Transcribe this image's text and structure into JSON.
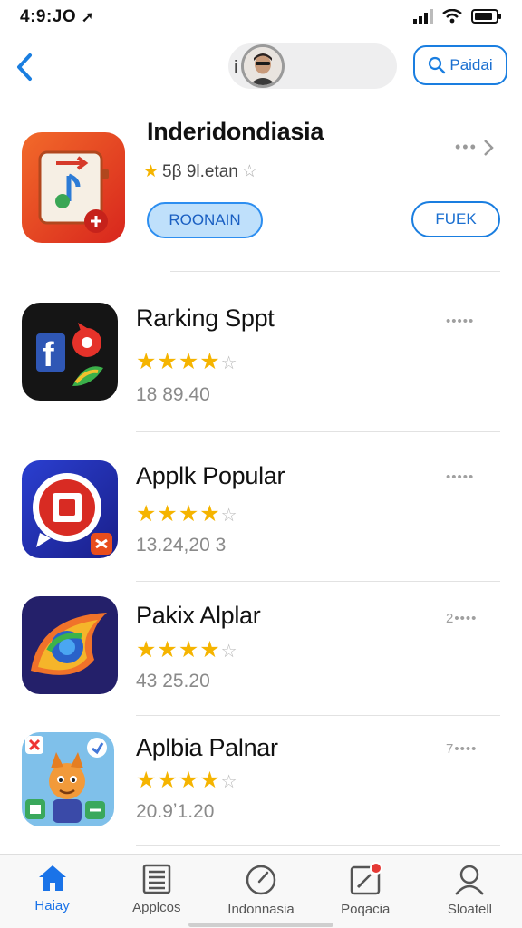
{
  "status_bar": {
    "time": "4:9:ЈО"
  },
  "nav": {
    "cursor_glyph": "i",
    "action_button_label": "Paidai"
  },
  "featured": {
    "title": "Inderidondiasia",
    "rating_text": "5β 9l.etan",
    "primary_button_label": "ROONAIN",
    "secondary_button_label": "FUEK"
  },
  "apps": [
    {
      "name": "Rarking Sppt",
      "rating": 4,
      "meta": "18 89.40",
      "more": ""
    },
    {
      "name": "Applk Popular",
      "rating": 4,
      "meta": "13.24,20 3",
      "more": ""
    },
    {
      "name": "Pakix Alplar",
      "rating": 4,
      "meta": "43 25.20",
      "more": "2"
    },
    {
      "name": "Aplbia Palnar",
      "rating": 4,
      "meta": "20.9ʼ1.20",
      "more": "7"
    }
  ],
  "tab_bar": {
    "items": [
      {
        "label": "Haiay",
        "icon": "home-icon",
        "active": true
      },
      {
        "label": "Applcos",
        "icon": "list-icon",
        "active": false
      },
      {
        "label": "Indonnasia",
        "icon": "compass-icon",
        "active": false
      },
      {
        "label": "Poqacia",
        "icon": "edit-icon",
        "active": false
      },
      {
        "label": "Sloatell",
        "icon": "person-icon",
        "active": false
      }
    ]
  },
  "colors": {
    "accent": "#1a7ee0",
    "star": "#f5b400",
    "badge": "#e53935"
  }
}
